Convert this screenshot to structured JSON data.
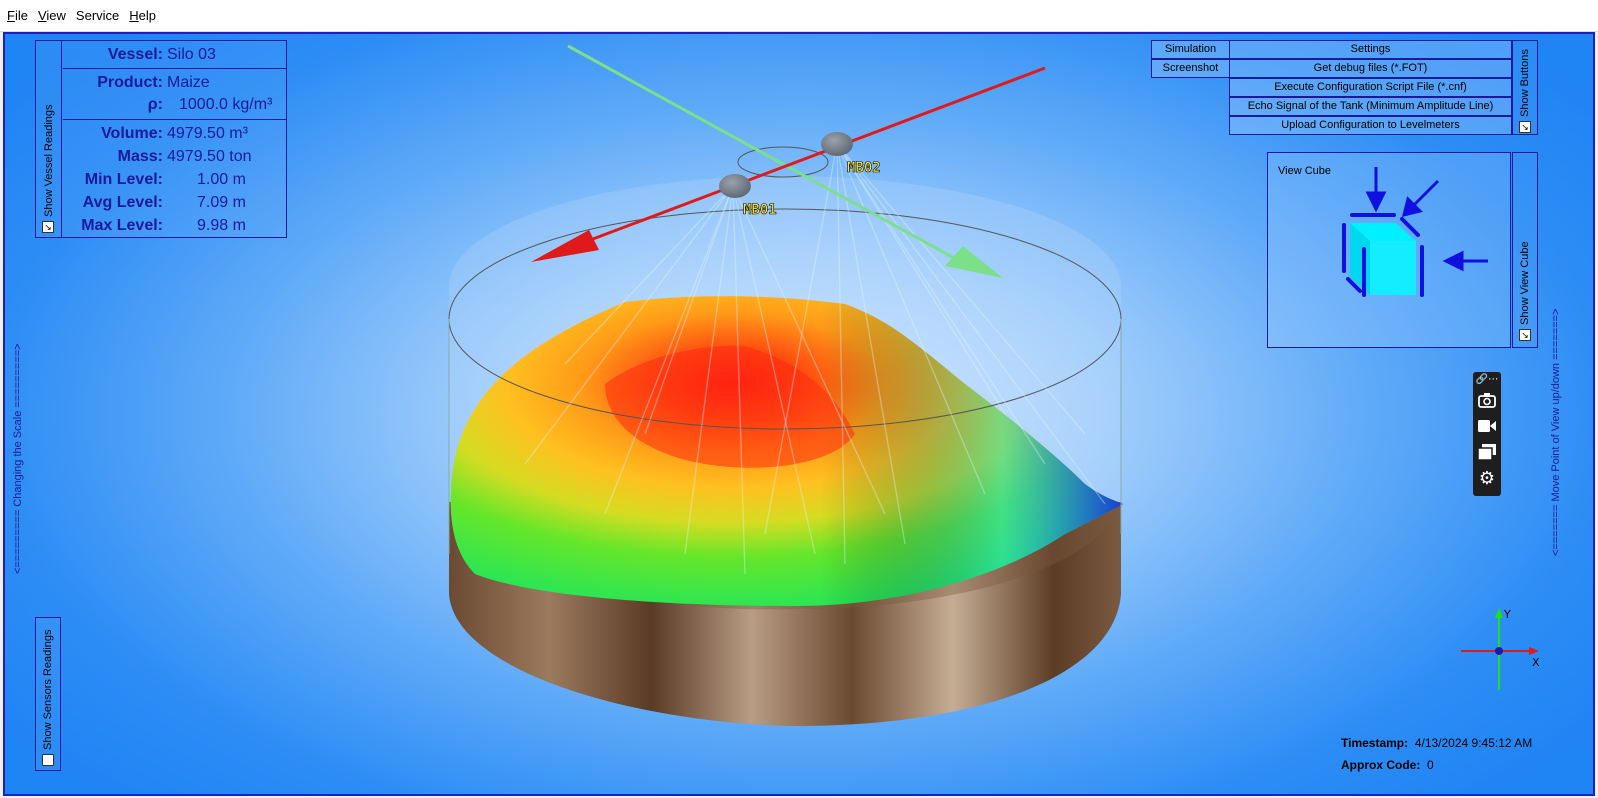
{
  "menu": {
    "items": [
      {
        "label": "File",
        "key": "F",
        "rest": "ile"
      },
      {
        "label": "View",
        "key": "V",
        "rest": "iew"
      },
      {
        "label": "Service",
        "key": "",
        "rest": "Service"
      },
      {
        "label": "Help",
        "key": "H",
        "rest": "elp"
      }
    ]
  },
  "vessel_panel": {
    "toggle_label": "Show Vessel Readings",
    "vessel_label": "Vessel:",
    "vessel_value": "Silo 03",
    "product_label": "Product:",
    "product_value": "Maize",
    "rho_label": "ρ:",
    "rho_value": "1000.0 kg/m³",
    "volume_label": "Volume:",
    "volume_value": "4979.50 m³",
    "mass_label": "Mass:",
    "mass_value": "4979.50 ton",
    "min_level_label": "Min Level:",
    "min_level_value": "1.00 m",
    "avg_level_label": "Avg Level:",
    "avg_level_value": "7.09 m",
    "max_level_label": "Max Level:",
    "max_level_value": "9.98 m"
  },
  "buttons": {
    "simulation": "Simulation",
    "screenshot": "Screenshot",
    "settings": "Settings",
    "get_debug": "Get debug files (*.FOT)",
    "execute_script": "Execute Configuration Script File (*.cnf)",
    "echo_signal": "Echo Signal of the Tank (Minimum Amplitude Line)",
    "upload_config": "Upload Configuration to Levelmeters",
    "show_buttons": "Show Buttons"
  },
  "view_cube": {
    "label": "View Cube",
    "toggle_label": "Show View Cube"
  },
  "sensors_panel": {
    "toggle_label": "Show Sensors Readings"
  },
  "scale_label": "<========= Changing the Scale =========>",
  "move_view_label": "<======= Move Point of View up/down =======>",
  "sensors": {
    "mb01": "MB01",
    "mb02": "MB02"
  },
  "axes": {
    "x": "X",
    "y": "Y"
  },
  "status": {
    "timestamp_label": "Timestamp:",
    "timestamp_value": "4/13/2024 9:45:12 AM",
    "approx_label": "Approx Code:",
    "approx_value": "0"
  },
  "icons": [
    "link-icon",
    "more-icon",
    "camera-icon",
    "video-icon",
    "window-icon",
    "gear-icon",
    "chevron-down-icon"
  ]
}
